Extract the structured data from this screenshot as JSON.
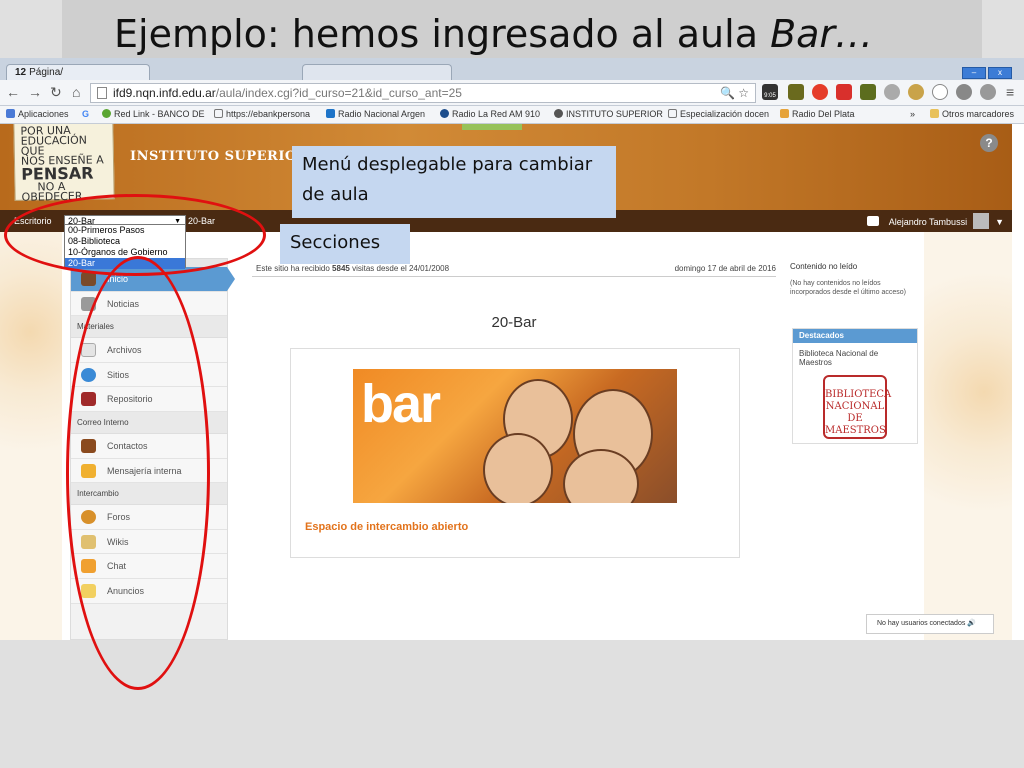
{
  "slide": {
    "title_plain": "Ejemplo: hemos ingresado al aula ",
    "title_italic": "Bar…"
  },
  "browser": {
    "tab_number": "12",
    "tab_label": "Página/",
    "url_host": "ifd9.nqn.infd.edu.ar",
    "url_path": "/aula/index.cgi?id_curso=21&id_curso_ant=25",
    "time_badge": "9:05",
    "bookmarks": [
      "Aplicaciones",
      "G",
      "Red Link - BANCO DE",
      "https://ebankpersona",
      "Radio Nacional Argen",
      "Radio La Red AM 910",
      "INSTITUTO SUPERIOR",
      "Especialización docen",
      "Radio Del Plata",
      "»",
      "Otros marcadores"
    ]
  },
  "site": {
    "logo_lines": [
      "POR UNA",
      "EDUCACIÓN QUE",
      "NOS ENSEÑE A",
      "PENSAR",
      "NO A",
      "OBEDECER"
    ],
    "institute": "INSTITUTO SUPERIOR D",
    "help": "?",
    "course_bar": {
      "escritorio": "Escritorio",
      "selected": "20-Bar",
      "current": "20-Bar",
      "user": "Alejandro Tambussi"
    },
    "dropdown_options": [
      "00-Primeros Pasos",
      "08-Biblioteca",
      "10-Órganos de Gobierno",
      "20-Bar"
    ]
  },
  "sidebar": {
    "items": [
      {
        "label": "Inicio",
        "icon": "home-icon"
      },
      {
        "label": "Noticias",
        "icon": "news-icon"
      },
      {
        "header": "Materiales"
      },
      {
        "label": "Archivos",
        "icon": "file-icon"
      },
      {
        "label": "Sitios",
        "icon": "globe-icon"
      },
      {
        "label": "Repositorio",
        "icon": "briefcase-icon"
      },
      {
        "header": "Correo Interno"
      },
      {
        "label": "Contactos",
        "icon": "contacts-icon"
      },
      {
        "label": "Mensajería interna",
        "icon": "envelope-icon"
      },
      {
        "header": "Intercambio"
      },
      {
        "label": "Foros",
        "icon": "forum-icon"
      },
      {
        "label": "Wikis",
        "icon": "wiki-icon"
      },
      {
        "label": "Chat",
        "icon": "chat-icon"
      },
      {
        "label": "Anuncios",
        "icon": "megaphone-icon"
      }
    ]
  },
  "content": {
    "visits_prefix": "Este sitio ha recibido ",
    "visits_count": "5845",
    "visits_suffix": " visitas desde el 24/01/2008",
    "date": "domingo 17 de abril de 2016",
    "course_title": "20-Bar",
    "banner_word": "bar",
    "caption": "Espacio de intercambio abierto"
  },
  "right": {
    "unread_title": "Contenido no leído",
    "unread_text": "(No hay contenidos no leídos incorporados desde el último acceso)",
    "featured_title": "Destacados",
    "featured_item": "Biblioteca Nacional de Maestros",
    "featured_logo": "BIBLIOTECA NACIONAL DE MAESTROS",
    "online": "No hay usuarios conectados"
  },
  "annotations": {
    "dropdown_callout": "Menú desplegable para cambiar de aula",
    "sections_callout": "Secciones"
  },
  "colors": {
    "accent_blue": "#5b9ad2",
    "header_orange": "#c27828",
    "annotation_red": "#e01010",
    "callout_blue": "#c5d7f0"
  }
}
